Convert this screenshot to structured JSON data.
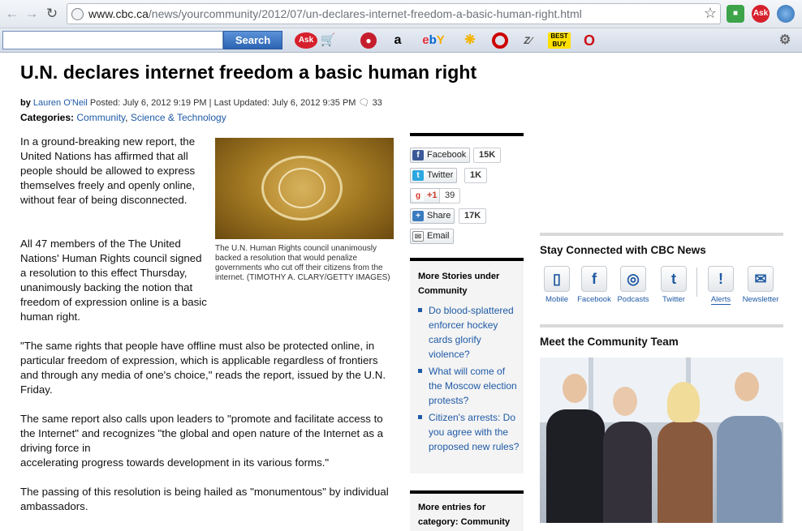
{
  "browser": {
    "url_host": "www.cbc.ca",
    "url_path": "/news/yourcommunity/2012/07/un-declares-internet-freedom-a-basic-human-right.html"
  },
  "toolbar": {
    "search_value": "",
    "search_button": "Search",
    "items": [
      "Ask",
      "amazon",
      "ebay",
      "walmart",
      "target",
      "zappos",
      "best buy",
      "opera"
    ]
  },
  "article": {
    "title": "U.N. declares internet freedom a basic human right",
    "byline_by": "by",
    "author": "Lauren O'Neil",
    "posted": "Posted: July 6, 2012 9:19 PM",
    "updated": "Last Updated: July 6, 2012 9:35 PM",
    "comments": "33",
    "categories_label": "Categories:",
    "category_1": "Community",
    "category_2": "Science & Technology",
    "para1": "In a ground-breaking new report, the United Nations has affirmed that all people should be allowed to express themselves freely and openly online, without fear of being disconnected.",
    "para2": "All 47 members of the The United Nations' Human Rights council signed a resolution to this effect Thursday, unanimously backing the notion that freedom of expression online is a basic human right.",
    "para3": "\"The same rights that people have offline must also be protected online, in particular freedom of expression, which is applicable regardless of frontiers and through any media of one's choice,\" reads the report, issued by the U.N. Friday.",
    "para4a": "The same report also calls upon leaders to \"promote and facilitate access to the Internet\" and recognizes \"the global and open nature of the Internet as a driving force in",
    "para4b": "accelerating progress towards development in its various forms.\"",
    "para5": "The passing of this resolution is being hailed as \"monumentous\" by individual ambassadors.",
    "caption": "The U.N. Human Rights council unanimously backed a resolution that would penalize governments who cut off their citizens from the internet. (TIMOTHY A. CLARY/GETTY IMAGES)"
  },
  "share": {
    "facebook": "Facebook",
    "facebook_count": "15K",
    "twitter": "Twitter",
    "twitter_count": "1K",
    "gplus": "+1",
    "gplus_count": "39",
    "share": "Share",
    "share_count": "17K",
    "email": "Email"
  },
  "more_stories": {
    "heading": "More Stories under Community",
    "items": [
      "Do blood-splattered enforcer hockey cards glorify violence?",
      "What will come of the Moscow election protests?",
      "Citizen's arrests: Do you agree with the proposed new rules?"
    ],
    "entries_heading": "More entries for category: Community"
  },
  "sidebar": {
    "stay_connected": "Stay Connected with CBC News",
    "links": [
      "Mobile",
      "Facebook",
      "Podcasts",
      "Twitter",
      "Alerts",
      "Newsletter"
    ],
    "team_heading": "Meet the Community Team"
  },
  "colors": {
    "link": "#1f5aa6",
    "search_button": "#2c64b3"
  }
}
